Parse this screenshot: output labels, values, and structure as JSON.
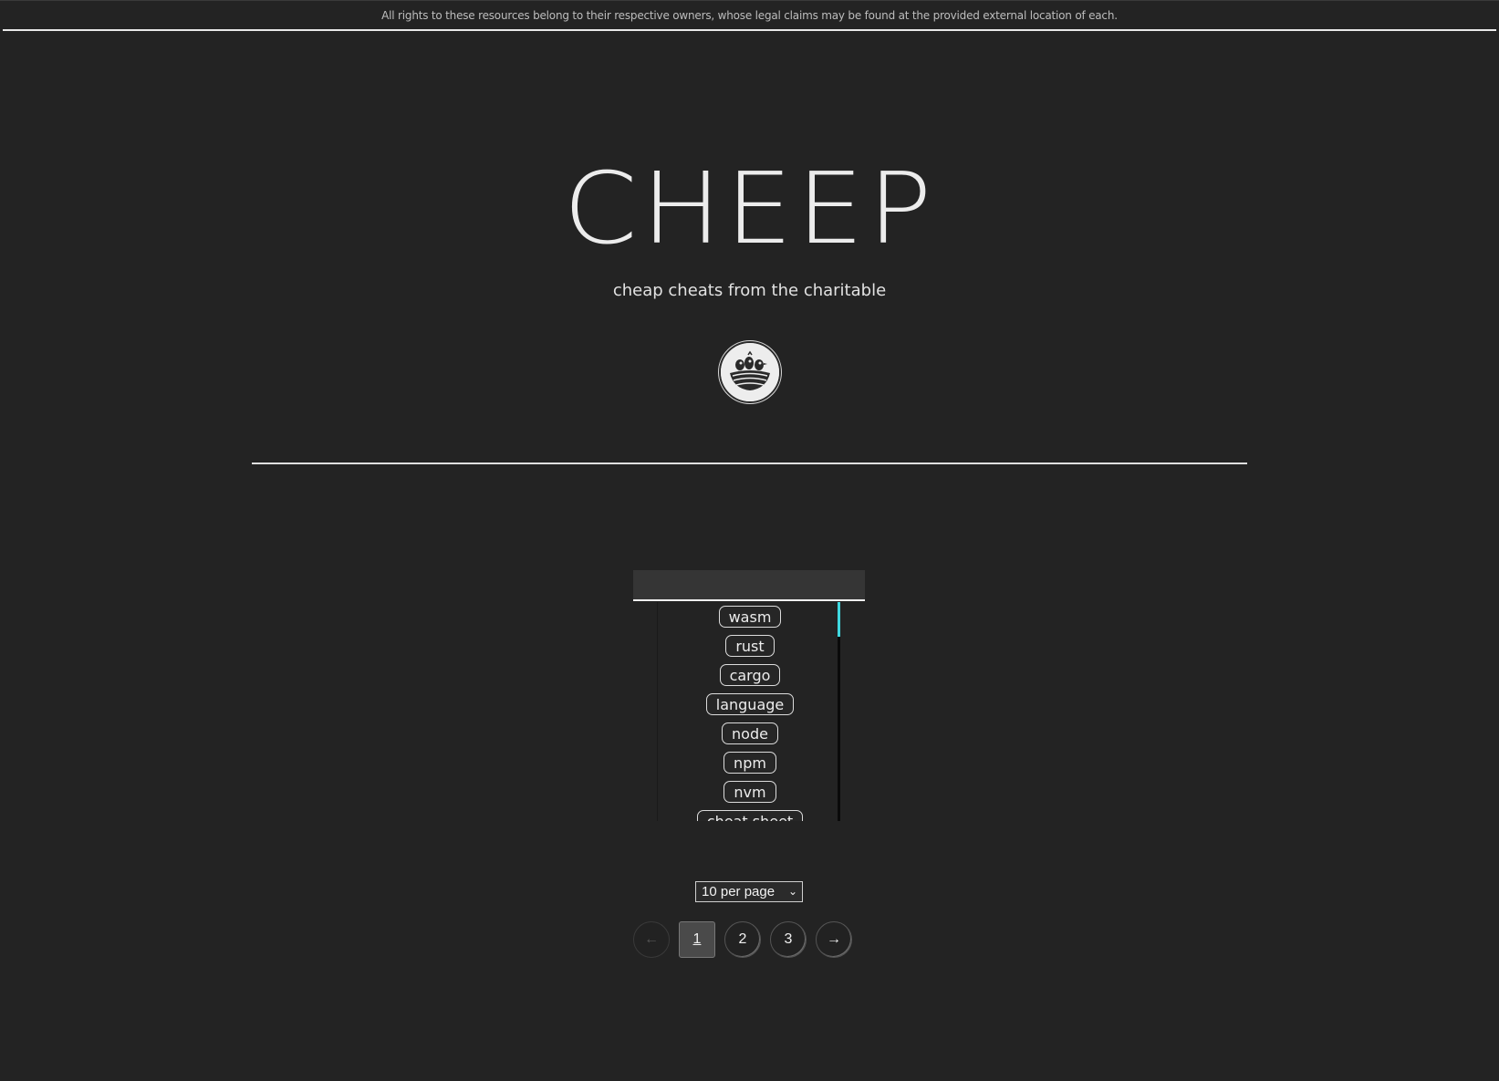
{
  "notice": "All rights to these resources belong to their respective owners, whose legal claims may be found at the provided external location of each.",
  "header": {
    "title": "CHEEP",
    "tagline": "cheap cheats from the charitable",
    "logo_icon": "bird-nest-logo"
  },
  "search": {
    "value": "",
    "placeholder": ""
  },
  "tags": [
    "wasm",
    "rust",
    "cargo",
    "language",
    "node",
    "npm",
    "nvm",
    "cheat sheet"
  ],
  "pagination": {
    "per_page_label": "10 per page",
    "prev_icon": "←",
    "next_icon": "→",
    "pages": [
      "1",
      "2",
      "3"
    ],
    "current_page": "1"
  },
  "colors": {
    "background": "#232323",
    "text": "#e6e6e6",
    "scroll_thumb": "#3fd8e0"
  }
}
